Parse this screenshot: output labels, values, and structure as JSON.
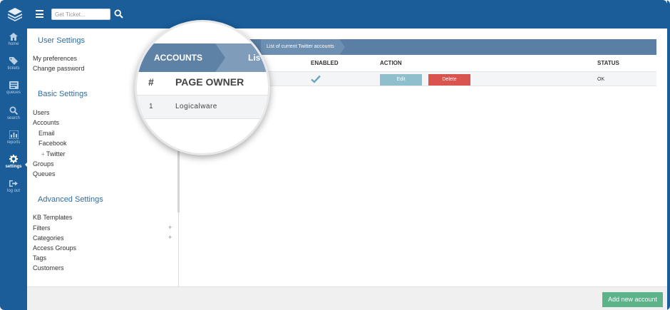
{
  "topbar": {
    "search_placeholder": "Get Ticket..."
  },
  "nav": {
    "items": [
      {
        "label": "home",
        "icon": "home-icon"
      },
      {
        "label": "tickets",
        "icon": "tag-icon"
      },
      {
        "label": "queues",
        "icon": "queue-icon"
      },
      {
        "label": "search",
        "icon": "search-icon"
      },
      {
        "label": "reports",
        "icon": "bar-chart-icon"
      },
      {
        "label": "settings",
        "icon": "gear-icon",
        "active": true
      },
      {
        "label": "log out",
        "icon": "logout-icon"
      }
    ]
  },
  "settings": {
    "user_settings": {
      "title": "User Settings",
      "links": [
        "My preferences",
        "Change password"
      ]
    },
    "basic_settings": {
      "title": "Basic Settings",
      "links": {
        "users": "Users",
        "accounts": "Accounts",
        "email": "Email",
        "facebook": "Facebook",
        "twitter": "Twitter",
        "groups": "Groups",
        "queues": "Queues"
      },
      "twitter_marker": "+"
    },
    "advanced_settings": {
      "title": "Advanced Settings",
      "links": {
        "kb_templates": "KB Templates",
        "filters": "Filters",
        "categories": "Categories",
        "access_groups": "Access Groups",
        "tags": "Tags",
        "customers": "Customers"
      },
      "expand_marker": "+"
    }
  },
  "accounts_table": {
    "breadcrumb": "List of current Twitter accounts",
    "columns": {
      "enabled": "ENABLED",
      "action": "ACTION",
      "status": "STATUS"
    },
    "rows": [
      {
        "edit_label": "Edit",
        "delete_label": "Delete",
        "status": "OK",
        "enabled": true
      }
    ]
  },
  "magnifier": {
    "tab": "ACCOUNTS",
    "tab_next": "Lis",
    "col_hash": "#",
    "col_owner": "PAGE OWNER",
    "row_num": "1",
    "row_owner": "Logicalware"
  },
  "footer": {
    "add_label": "Add new account"
  },
  "colors": {
    "brand": "#1a5d99",
    "header_bar": "#5a7fa5",
    "edit": "#8fbfcc",
    "delete": "#d9534f",
    "add": "#5cb38a",
    "check": "#6aa8b8"
  }
}
